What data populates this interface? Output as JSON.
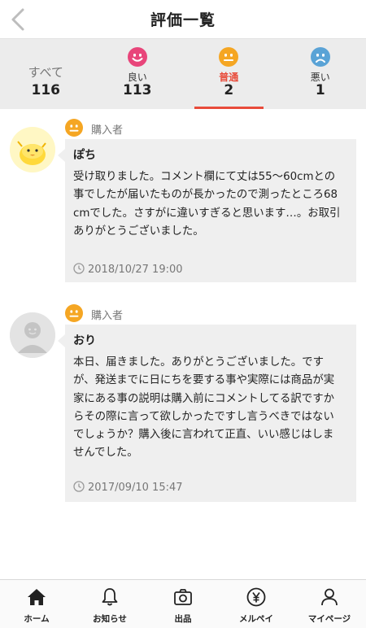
{
  "header": {
    "title": "評価一覧",
    "back_icon": "chevron-left-icon"
  },
  "tabs": [
    {
      "label": "すべて",
      "count": "116",
      "icon": null
    },
    {
      "label": "良い",
      "count": "113",
      "icon": "smile-face-icon",
      "color": "#e8457a"
    },
    {
      "label": "普通",
      "count": "2",
      "icon": "neutral-face-icon",
      "color": "#f5a623",
      "active": true
    },
    {
      "label": "悪い",
      "count": "1",
      "icon": "sad-face-icon",
      "color": "#5aa3d6"
    }
  ],
  "reviews": [
    {
      "role": "購入者",
      "name": "ぽち",
      "comment": "受け取りました。コメント欄にて丈は55〜60cmとの事でしたが届いたものが長かったので測ったところ68cmでした。さすがに違いすぎると思います…。お取引ありがとうございました。",
      "date": "2018/10/27 19:00",
      "avatar": "egg-character-avatar"
    },
    {
      "role": "購入者",
      "name": "おり",
      "comment": "本日、届きました。ありがとうございました。ですが、発送までに日にちを要する事や実際には商品が実家にある事の説明は購入前にコメントしてる訳ですからその際に言って欲しかったですし言うべきではないでしょうか？購入後に言われて正直、いい感じはしませんでした。",
      "date": "2017/09/10 15:47",
      "avatar": "default-avatar"
    }
  ],
  "bottom_nav": [
    {
      "label": "ホーム",
      "icon": "home-icon"
    },
    {
      "label": "お知らせ",
      "icon": "bell-icon"
    },
    {
      "label": "出品",
      "icon": "camera-icon"
    },
    {
      "label": "メルペイ",
      "icon": "yen-icon"
    },
    {
      "label": "マイページ",
      "icon": "person-icon"
    }
  ],
  "colors": {
    "accent": "#e84b3a",
    "neutral_face": "#f5a623"
  }
}
